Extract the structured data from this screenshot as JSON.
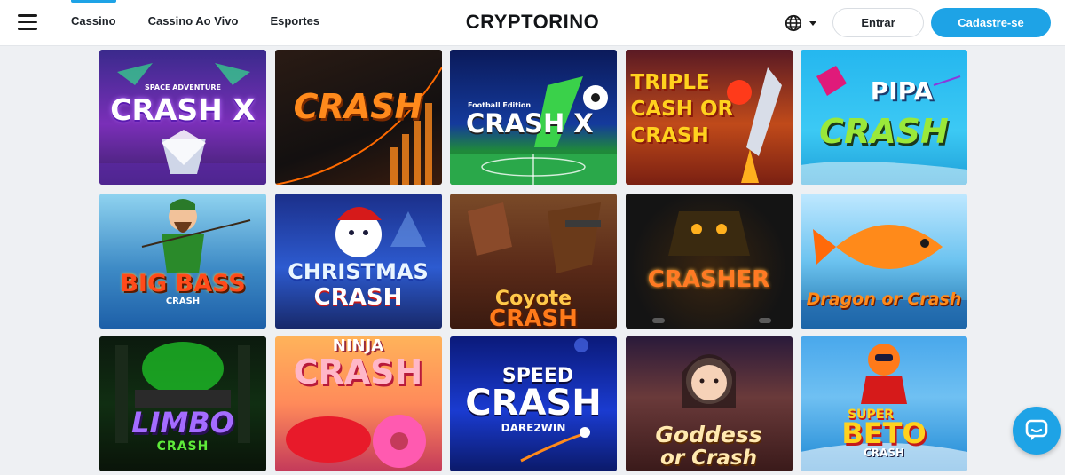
{
  "header": {
    "menu_icon": "hamburger-menu-icon",
    "nav": [
      {
        "label": "Cassino",
        "active": true
      },
      {
        "label": "Cassino Ao Vivo",
        "active": false
      },
      {
        "label": "Esportes",
        "active": false
      }
    ],
    "logo": "CRYPTORINO",
    "language_icon": "globe-icon",
    "login_label": "Entrar",
    "signup_label": "Cadastre-se"
  },
  "colors": {
    "accent": "#1ea3e6",
    "background": "#eef0f3",
    "header_bg": "#ffffff",
    "text": "#1e2329"
  },
  "games": [
    {
      "title": [
        "SPACE ADVENTURE",
        "CRASH X"
      ]
    },
    {
      "title": [
        "CRASH"
      ]
    },
    {
      "title": [
        "Football Edition",
        "CRASH X"
      ]
    },
    {
      "title": [
        "TRIPLE CASH OR CRASH"
      ]
    },
    {
      "title": [
        "PIPA",
        "CRASH"
      ]
    },
    {
      "title": [
        "BIG BASS",
        "CRASH"
      ]
    },
    {
      "title": [
        "CHRISTMAS",
        "CRASH"
      ]
    },
    {
      "title": [
        "Coyote",
        "CRASH"
      ]
    },
    {
      "title": [
        "CRASHER"
      ]
    },
    {
      "title": [
        "Dragon or Crash"
      ]
    },
    {
      "title": [
        "LIMBO",
        "CRASH"
      ]
    },
    {
      "title": [
        "NINJA",
        "CRASH"
      ]
    },
    {
      "title": [
        "SPEED",
        "CRASH",
        "DARE2WIN"
      ]
    },
    {
      "title": [
        "Goddess",
        "or Crash"
      ]
    },
    {
      "title": [
        "SUPER",
        "BETO",
        "CRASH"
      ]
    }
  ],
  "chat_icon": "chat-bubble-icon"
}
